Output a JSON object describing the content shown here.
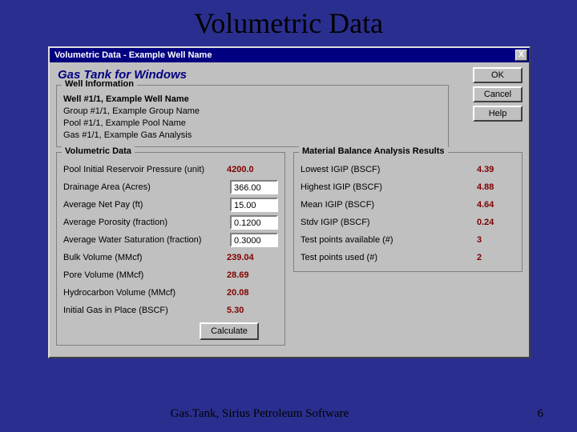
{
  "slide": {
    "title": "Volumetric Data",
    "footer": "Gas.Tank, Sirius Petroleum Software",
    "page": "6"
  },
  "window": {
    "title": "Volumetric Data - Example Well Name",
    "close": "X",
    "app": "Gas Tank for Windows"
  },
  "buttons": {
    "ok": "OK",
    "cancel": "Cancel",
    "help": "Help",
    "calc": "Calculate"
  },
  "well_info": {
    "legend": "Well Information",
    "well": "Well #1/1, Example Well Name",
    "group": "Group #1/1, Example Group Name",
    "pool": "Pool #1/1, Example Pool Name",
    "gas": "Gas #1/1, Example Gas Analysis"
  },
  "vol": {
    "legend": "Volumetric Data",
    "pres_lbl": "Pool Initial Reservoir Pressure (unit)",
    "pres_val": "4200.0",
    "area_lbl": "Drainage Area (Acres)",
    "area_val": "366.00",
    "pay_lbl": "Average Net Pay (ft)",
    "pay_val": "15.00",
    "por_lbl": "Average Porosity (fraction)",
    "por_val": "0.1200",
    "sw_lbl": "Average Water Saturation (fraction)",
    "sw_val": "0.3000",
    "bulk_lbl": "Bulk Volume (MMcf)",
    "bulk_val": "239.04",
    "pore_lbl": "Pore Volume (MMcf)",
    "pore_val": "28.69",
    "hc_lbl": "Hydrocarbon Volume (MMcf)",
    "hc_val": "20.08",
    "igip_lbl": "Initial Gas in Place (BSCF)",
    "igip_val": "5.30"
  },
  "mbar": {
    "legend": "Material Balance Analysis Results",
    "low_lbl": "Lowest IGIP (BSCF)",
    "low_val": "4.39",
    "high_lbl": "Highest IGIP (BSCF)",
    "high_val": "4.88",
    "mean_lbl": "Mean IGIP (BSCF)",
    "mean_val": "4.64",
    "stdv_lbl": "Stdv IGIP (BSCF)",
    "stdv_val": "0.24",
    "avail_lbl": "Test points available (#)",
    "avail_val": "3",
    "used_lbl": "Test points used (#)",
    "used_val": "2"
  }
}
